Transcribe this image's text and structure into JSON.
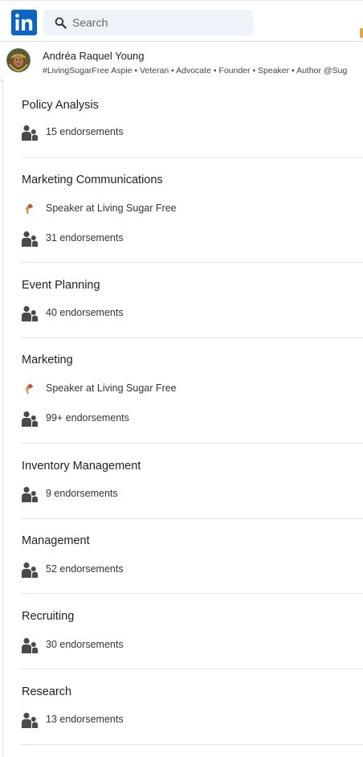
{
  "topbar": {
    "logo_text": "in",
    "search": {
      "placeholder": "Search",
      "value": ""
    }
  },
  "profile": {
    "name": "Andréa Raquel Young",
    "headline": "#LivingSugarFree Aspie • Veteran • Advocate • Founder • Speaker • Author @Sug"
  },
  "skills": [
    {
      "name": "Policy Analysis",
      "endorsements": "15 endorsements"
    },
    {
      "name": "Marketing Communications",
      "experience": "Speaker at Living Sugar Free",
      "endorsements": "31 endorsements"
    },
    {
      "name": "Event Planning",
      "endorsements": "40 endorsements"
    },
    {
      "name": "Marketing",
      "experience": "Speaker at Living Sugar Free",
      "endorsements": "99+ endorsements"
    },
    {
      "name": "Inventory Management",
      "endorsements": "9 endorsements"
    },
    {
      "name": "Management",
      "endorsements": "52 endorsements"
    },
    {
      "name": "Recruiting",
      "endorsements": "30 endorsements"
    },
    {
      "name": "Research",
      "endorsements": "13 endorsements"
    }
  ],
  "icons": {
    "endorsement": "people-icon",
    "experience": "company-logo-icon"
  },
  "colors": {
    "brand": "#0a66c2",
    "search_bg": "#edf3f8",
    "icon_gray": "#4a4a4a",
    "divider": "#e4e4e4"
  }
}
